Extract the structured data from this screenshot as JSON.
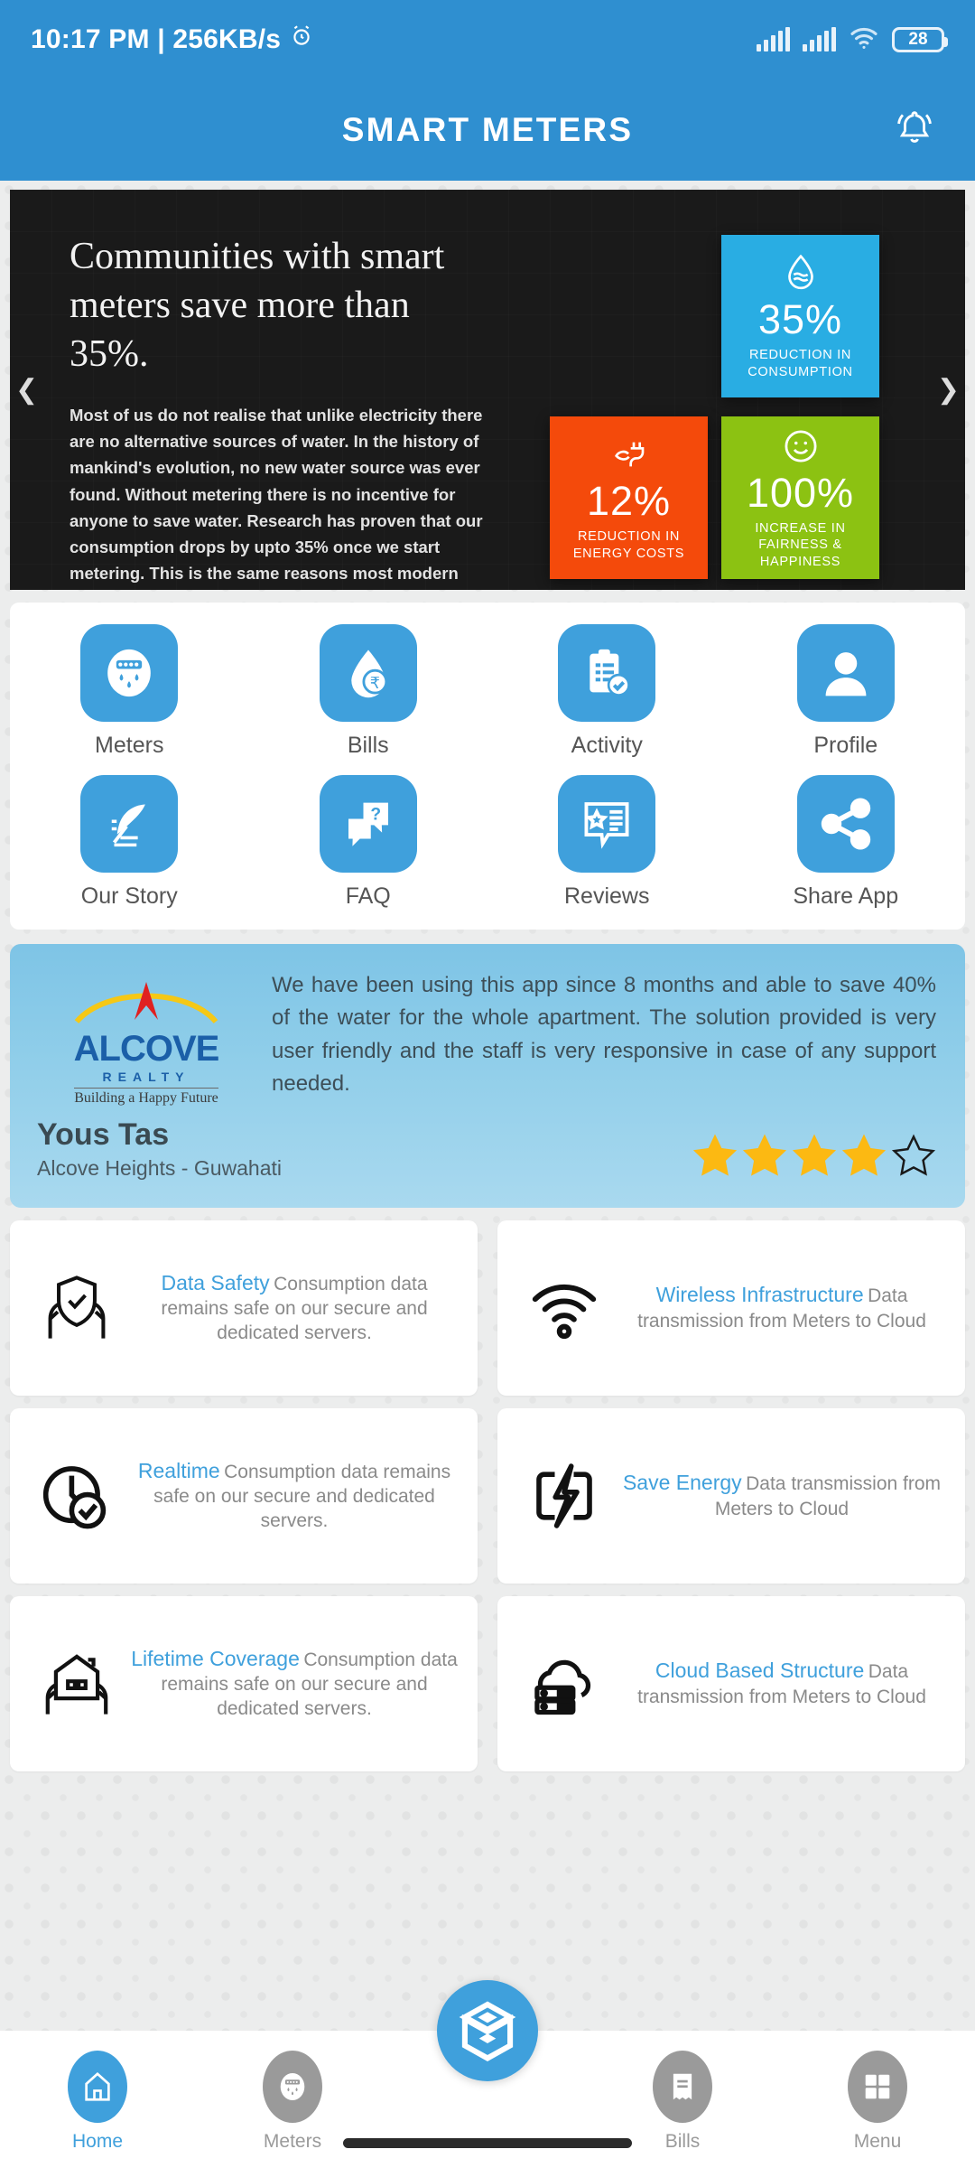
{
  "status_bar": {
    "time_and_net": "10:17 PM | 256KB/s",
    "alarm_icon": "alarm-clock-icon",
    "battery_percent": "28",
    "wifi_icon": "wifi-icon",
    "signal_icon": "signal-bars-icon"
  },
  "app_bar": {
    "title": "SMART METERS",
    "notification_icon": "bell-icon"
  },
  "banner": {
    "headline": "Communities with smart meters save more than 35%.",
    "body": "Most of us do not realise that unlike electricity there are no alternative sources of water. In the history of mankind's evolution, no new water source was ever found. Without metering there is no incentive for anyone to save water. Research has proven that our consumption drops by upto 35% once we start metering. This is the same reasons most modern cars display instant fuel economy on the dashboard!",
    "prev_arrow": "❮",
    "next_arrow": "❯",
    "tiles": [
      {
        "value": "35%",
        "caption": "REDUCTION IN CONSUMPTION",
        "color": "#29ade3",
        "icon": "water-drop-icon"
      },
      {
        "value": "12%",
        "caption": "REDUCTION IN ENERGY COSTS",
        "color": "#f44a0b",
        "icon": "plug-leaf-icon"
      },
      {
        "value": "100%",
        "caption": "INCREASE IN FAIRNESS & HAPPINESS",
        "color": "#8cc212",
        "icon": "smiley-face-icon"
      }
    ]
  },
  "shortcuts": [
    {
      "label": "Meters",
      "icon": "water-meter-icon"
    },
    {
      "label": "Bills",
      "icon": "rupee-drop-icon"
    },
    {
      "label": "Activity",
      "icon": "clipboard-check-icon"
    },
    {
      "label": "Profile",
      "icon": "user-avatar-icon"
    },
    {
      "label": "Our Story",
      "icon": "feather-quill-icon"
    },
    {
      "label": "FAQ",
      "icon": "question-chat-icon"
    },
    {
      "label": "Reviews",
      "icon": "star-review-icon"
    },
    {
      "label": "Share App",
      "icon": "share-nodes-icon"
    }
  ],
  "testimonial": {
    "logo_word": "ALCOVE",
    "logo_sub": "REALTY",
    "logo_tagline": "Building a Happy Future",
    "quote": "We have been using this app since 8 months and able to save 40% of the water for the whole apartment. The solution provided is very user friendly and the staff is very responsive in case of any support needed.",
    "name": "Yous Tas",
    "location": "Alcove Heights - Guwahati",
    "rating": 4,
    "rating_max": 5,
    "star_color": "#fcb912"
  },
  "features": [
    {
      "title": "Data Safety",
      "desc": "Consumption data remains safe on our secure and dedicated servers.",
      "icon": "shield-in-hands-icon"
    },
    {
      "title": "Wireless Infrastructure",
      "desc": "Data transmission from Meters to Cloud",
      "icon": "wifi-signal-icon"
    },
    {
      "title": "Realtime",
      "desc": "Consumption data remains safe on our secure and dedicated servers.",
      "icon": "clock-check-icon"
    },
    {
      "title": "Save Energy",
      "desc": "Data transmission from Meters to Cloud",
      "icon": "battery-bolt-icon"
    },
    {
      "title": "Lifetime Coverage",
      "desc": "Consumption data remains safe on our secure and dedicated servers.",
      "icon": "house-in-hands-icon"
    },
    {
      "title": "Cloud Based Structure",
      "desc": "Data transmission from Meters to Cloud",
      "icon": "cloud-server-icon"
    }
  ],
  "bottom_nav": {
    "items": [
      {
        "label": "Home",
        "icon": "home-icon",
        "active": true
      },
      {
        "label": "Meters",
        "icon": "water-meter-icon",
        "active": false
      },
      {
        "label": "Bills",
        "icon": "receipt-icon",
        "active": false
      },
      {
        "label": "Menu",
        "icon": "grid-menu-icon",
        "active": false
      }
    ],
    "fab_icon": "app-cube-logo-icon"
  },
  "colors": {
    "brand_blue": "#3fa0dc",
    "appbar_blue": "#2f8fd0",
    "page_bg": "#eceded"
  }
}
